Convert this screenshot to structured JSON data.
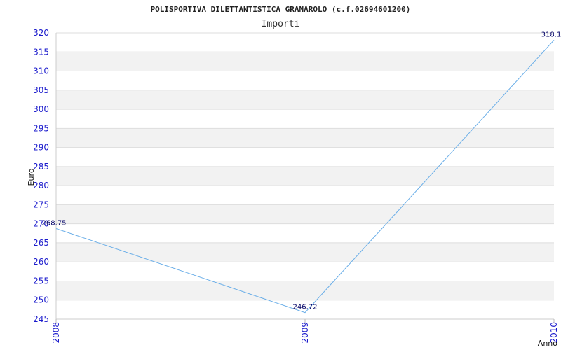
{
  "chart_data": {
    "type": "line",
    "title": "POLISPORTIVA DILETTANTISTICA GRANAROLO (c.f.02694601200)",
    "subtitle": "Importi",
    "xlabel": "Anno",
    "ylabel": "Euro",
    "categories": [
      "2008",
      "2009",
      "2010"
    ],
    "series": [
      {
        "values": [
          268.75,
          246.72,
          318.1
        ],
        "labels": [
          "268.75",
          "246.72",
          "318.1"
        ]
      }
    ],
    "ylim": [
      245,
      320
    ],
    "yticks": [
      245,
      250,
      255,
      260,
      265,
      270,
      275,
      280,
      285,
      290,
      295,
      300,
      305,
      310,
      315,
      320
    ],
    "grid": true,
    "colors": {
      "line": "#6aaee8",
      "tick_text": "#1a1acc",
      "band_fill": "#f2f2f2",
      "grid_line": "#dddddd",
      "data_label": "#000066"
    }
  }
}
